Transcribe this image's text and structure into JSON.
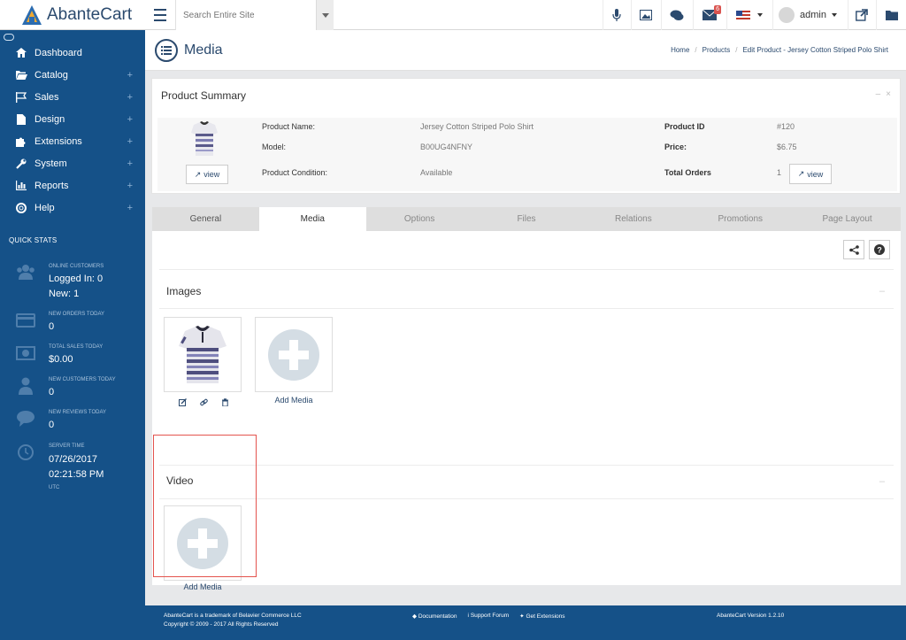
{
  "app": {
    "logo_text": "AbanteCart",
    "search_placeholder": "Search Entire Site",
    "messages_badge": "6",
    "username": "admin"
  },
  "sidebar": {
    "items": [
      {
        "label": "Dashboard",
        "icon": "home-icon",
        "expandable": false
      },
      {
        "label": "Catalog",
        "icon": "folder-icon",
        "expandable": true
      },
      {
        "label": "Sales",
        "icon": "flag-icon",
        "expandable": true
      },
      {
        "label": "Design",
        "icon": "file-icon",
        "expandable": true
      },
      {
        "label": "Extensions",
        "icon": "puzzle-icon",
        "expandable": true
      },
      {
        "label": "System",
        "icon": "wrench-icon",
        "expandable": true
      },
      {
        "label": "Reports",
        "icon": "bar-chart-icon",
        "expandable": true
      },
      {
        "label": "Help",
        "icon": "lifebuoy-icon",
        "expandable": true
      }
    ],
    "plus": "+",
    "quick_stats_title": "QUICK STATS",
    "stats": {
      "online_label": "ONLINE CUSTOMERS",
      "logged_in": "Logged In: 0",
      "new": "New: 1",
      "orders_label": "NEW ORDERS TODAY",
      "orders_value": "0",
      "sales_label": "TOTAL SALES TODAY",
      "sales_value": "$0.00",
      "customers_label": "NEW CUSTOMERS TODAY",
      "customers_value": "0",
      "reviews_label": "NEW REVIEWS TODAY",
      "reviews_value": "0",
      "server_label": "SERVER TIME",
      "server_date": "07/26/2017",
      "server_time": "02:21:58 PM",
      "server_tz": "UTC"
    }
  },
  "page": {
    "title": "Media",
    "breadcrumbs": [
      "Home",
      "Products",
      "Edit  Product - Jersey Cotton Striped Polo Shirt"
    ],
    "breadcrumb_sep": "/"
  },
  "summary": {
    "title": "Product Summary",
    "name_label": "Product Name:",
    "name_value": "Jersey Cotton Striped Polo Shirt",
    "model_label": "Model:",
    "model_value": "B00UG4NFNY",
    "condition_label": "Product Condition:",
    "condition_value": "Available",
    "id_label": "Product ID",
    "id_value": "#120",
    "price_label": "Price:",
    "price_value": "$6.75",
    "orders_label": "Total Orders",
    "orders_value": "1",
    "view_label": "view",
    "minimize": "–",
    "close": "×"
  },
  "tabs": [
    {
      "label": "General"
    },
    {
      "label": "Media",
      "active": true
    },
    {
      "label": "Options"
    },
    {
      "label": "Files"
    },
    {
      "label": "Relations"
    },
    {
      "label": "Promotions"
    },
    {
      "label": "Page Layout"
    }
  ],
  "images": {
    "title": "Images",
    "add_label": "Add Media",
    "minimize": "–"
  },
  "video": {
    "title": "Video",
    "add_label": "Add Media",
    "minimize": "–"
  },
  "footer": {
    "trademark": "AbanteCart is a trademark of Belavier Commerce LLC",
    "copyright": "Copyright © 2009 - 2017 All Rights Reserved",
    "documentation": "Documentation",
    "support": "Support Forum",
    "extensions": "Get Extensions",
    "version": "AbanteCart Version 1.2.10"
  },
  "colors": {
    "sidebar_bg": "#155188",
    "accent": "#2b4a6e",
    "highlight": "#e4544e",
    "badge": "#d9534f"
  }
}
